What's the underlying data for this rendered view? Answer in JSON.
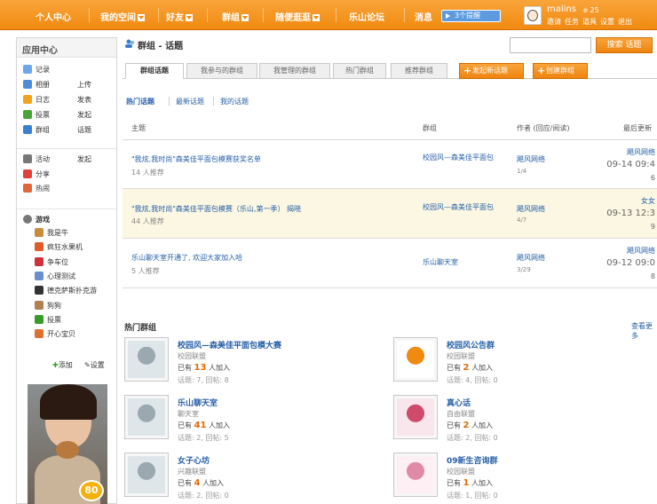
{
  "nav": {
    "items": [
      {
        "label": "个人中心",
        "dropdown": false
      },
      {
        "label": "我的空间",
        "dropdown": true
      },
      {
        "label": "好友",
        "dropdown": true
      },
      {
        "label": "群组",
        "dropdown": true
      },
      {
        "label": "随便逛逛",
        "dropdown": true
      },
      {
        "label": "乐山论坛",
        "dropdown": false
      },
      {
        "label": "消息",
        "dropdown": false
      }
    ],
    "remind": "3个提醒",
    "user": {
      "name": "malins",
      "score": "25",
      "links": [
        "邀请",
        "任务",
        "道具",
        "设置",
        "退出"
      ]
    },
    "accent": "#f08a10"
  },
  "sidebar": {
    "title": "应用中心",
    "items": [
      {
        "label": "记录",
        "action": "",
        "icon": "chat-bubble-icon",
        "color": "#6aa6e8"
      },
      {
        "label": "相册",
        "action": "上传",
        "icon": "photo-icon",
        "color": "#4d8bd6"
      },
      {
        "label": "日志",
        "action": "发表",
        "icon": "journal-icon",
        "color": "#f2a21d"
      },
      {
        "label": "投票",
        "action": "发起",
        "icon": "poll-icon",
        "color": "#4aa33a"
      },
      {
        "label": "群组",
        "action": "话题",
        "icon": "group-icon",
        "color": "#3b7fd0"
      },
      {
        "label": "活动",
        "action": "发起",
        "icon": "calendar-icon",
        "color": "#777777"
      },
      {
        "label": "分享",
        "action": "",
        "icon": "heart-icon",
        "color": "#e0413a"
      },
      {
        "label": "热闹",
        "action": "",
        "icon": "fire-icon",
        "color": "#e0663a"
      }
    ],
    "games_title": "游戏",
    "games": [
      {
        "label": "我是牛",
        "icon": "cow-icon",
        "color": "#c98a3c"
      },
      {
        "label": "疯狂水果机",
        "icon": "fruit-icon",
        "color": "#e05a2a"
      },
      {
        "label": "争车位",
        "icon": "car-icon",
        "color": "#d0303a"
      },
      {
        "label": "心理测试",
        "icon": "flask-icon",
        "color": "#6a8fd0"
      },
      {
        "label": "德克萨斯扑克游",
        "icon": "poker-icon",
        "color": "#333333"
      },
      {
        "label": "狗狗",
        "icon": "dog-icon",
        "color": "#b08050"
      },
      {
        "label": "投票",
        "icon": "bar-chart-icon",
        "color": "#3a9a2a"
      },
      {
        "label": "开心宝贝",
        "icon": "baby-icon",
        "color": "#e07030"
      }
    ],
    "add_label": "添加",
    "settings_label": "设置",
    "badge": "80"
  },
  "main": {
    "title": "群组 - 话题",
    "search_placeholder": "",
    "search_button": "搜索 话题",
    "tabs": [
      "群组话题",
      "我参与的群组",
      "我管理的群组",
      "热门群组",
      "推荐群组"
    ],
    "btn_new_topic": "发起新话题",
    "btn_new_group": "创建群组",
    "subtabs": [
      "热门话题",
      "最新话题",
      "我的话题"
    ],
    "table": {
      "headers": [
        "主题",
        "群组",
        "作者 (回应/阅读)",
        "最后更新"
      ],
      "rows": [
        {
          "title": "\"我炫,我时尚\"森美佳平面包模赛获奖名单",
          "recommend": "14 人推荐",
          "group": "校园风—森美佳平面包",
          "author": "飓风网络",
          "counts": "1/4",
          "last_user": "飓风网络",
          "last_time": "09-14 09:4",
          "last_extra": "6"
        },
        {
          "title": "\"我炫,我时尚\"森美佳平面包模赛（乐山,第一季） 揭晓",
          "recommend": "44 人推荐",
          "group": "校园风—森美佳平面包",
          "author": "飓风网络",
          "counts": "4/7",
          "last_user": "女女",
          "last_time": "09-13 12:3",
          "last_extra": "9"
        },
        {
          "title": "乐山聊天室开通了, 欢迎大家加入哈",
          "recommend": "5 人推荐",
          "group": "乐山聊天室",
          "author": "飓风网络",
          "counts": "3/29",
          "last_user": "飓风网络",
          "last_time": "09-12 09:0",
          "last_extra": "8"
        }
      ]
    },
    "hot_groups_title": "热门群组",
    "more_label": "查看更多",
    "groups": [
      {
        "name": "校园风—森美佳平面包模大赛",
        "category": "校园联盟",
        "prefix": "已有",
        "members": "13",
        "suffix": "人加入",
        "stats": "话题: 7, 回帖: 8",
        "icon": "group-photo-icon"
      },
      {
        "name": "校园风公告群",
        "category": "校园联盟",
        "prefix": "已有",
        "members": "2",
        "suffix": "人加入",
        "stats": "话题: 4, 回帖: 0",
        "icon": "megaphone-icon"
      },
      {
        "name": "乐山聊天室",
        "category": "聊天室",
        "prefix": "已有",
        "members": "41",
        "suffix": "人加入",
        "stats": "话题: 2, 回帖: 5",
        "icon": "group-photo-icon"
      },
      {
        "name": "真心话",
        "category": "自由联盟",
        "prefix": "已有",
        "members": "2",
        "suffix": "人加入",
        "stats": "话题: 2, 回帖: 0",
        "icon": "flowers-icon"
      },
      {
        "name": "女子心坊",
        "category": "兴趣联盟",
        "prefix": "已有",
        "members": "4",
        "suffix": "人加入",
        "stats": "话题: 2, 回帖: 0",
        "icon": "group-photo-icon"
      },
      {
        "name": "09新生咨询群",
        "category": "校园联盟",
        "prefix": "已有",
        "members": "1",
        "suffix": "人加入",
        "stats": "话题: 1, 回帖: 0",
        "icon": "cartoon-girl-icon"
      }
    ]
  }
}
